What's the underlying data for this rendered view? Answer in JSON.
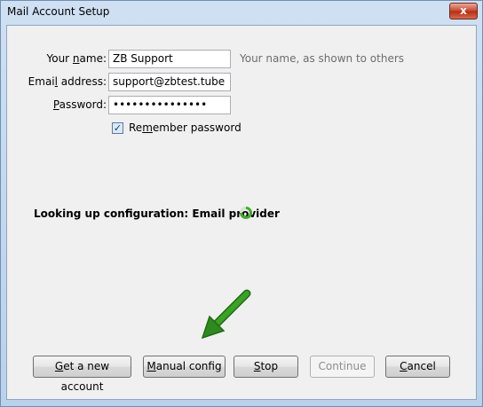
{
  "window": {
    "title": "Mail Account Setup",
    "close_glyph": "x"
  },
  "form": {
    "name_label_pre": "Your ",
    "name_label_key": "n",
    "name_label_post": "ame:",
    "name_value": "ZB Support",
    "name_hint": "Your name, as shown to others",
    "email_label_pre": "Emai",
    "email_label_key": "l",
    "email_label_post": " address:",
    "email_value": "support@zbtest.tube",
    "password_label_key": "P",
    "password_label_post": "assword:",
    "password_value": "•••••••••••••••",
    "remember_pre": "Re",
    "remember_key": "m",
    "remember_post": "ember password",
    "remember_checked": true
  },
  "status": {
    "text": "Looking up configuration: Email provider"
  },
  "buttons": {
    "new_account_key": "G",
    "new_account_rest": "et a new account",
    "manual_key": "M",
    "manual_rest": "anual config",
    "stop_key": "S",
    "stop_rest": "top",
    "continue_label": "Continue",
    "cancel_key": "C",
    "cancel_rest": "ancel"
  },
  "icons": {
    "spinner": "spinner-icon",
    "arrow": "arrow-icon",
    "check": "checkmark-icon"
  },
  "colors": {
    "spinner": "#3fae2a",
    "arrow": "#2e8a1c",
    "close": "#c8452a"
  }
}
